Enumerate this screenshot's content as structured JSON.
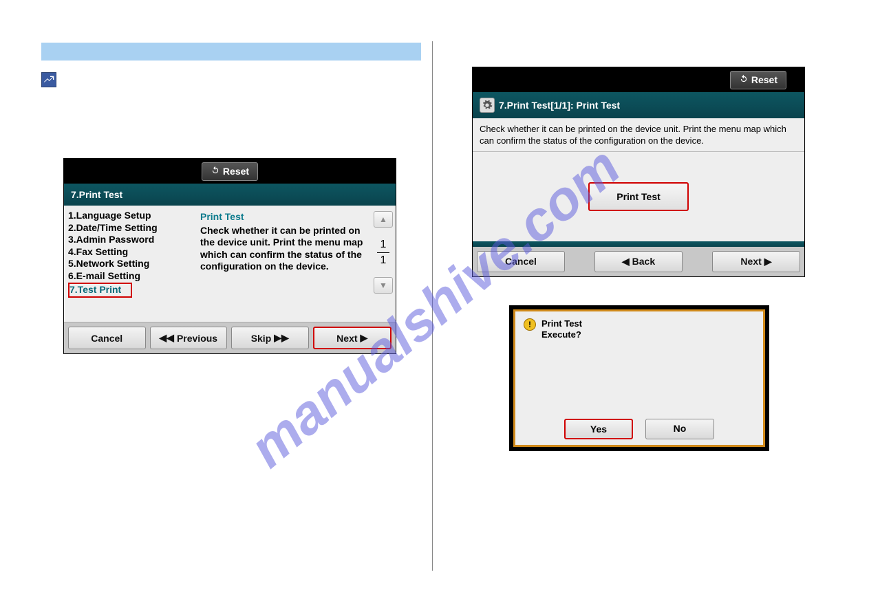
{
  "watermark": "manualshive.com",
  "shot1": {
    "reset_label": "Reset",
    "header": "7.Print Test",
    "menu": [
      "1.Language Setup",
      "2.Date/Time Setting",
      "3.Admin Password",
      "4.Fax Setting",
      "5.Network Setting",
      "6.E-mail Setting",
      "7.Test Print"
    ],
    "desc_title": "Print Test",
    "desc_body": "Check whether it can be printed on the device unit. Print the menu map which can confirm the status of the configuration on the device.",
    "page_current": "1",
    "page_total": "1",
    "btn_cancel": "Cancel",
    "btn_previous": "Previous",
    "btn_skip": "Skip",
    "btn_next": "Next"
  },
  "shot2": {
    "reset_label": "Reset",
    "header": "7.Print Test[1/1]: Print Test",
    "instruction": "Check whether it can be printed on the device unit. Print the menu map which can confirm the status of the configuration on the device.",
    "btn_print_test": "Print Test",
    "btn_cancel": "Cancel",
    "btn_back": "Back",
    "btn_next": "Next"
  },
  "shot3": {
    "line1": "Print Test",
    "line2": "Execute?",
    "btn_yes": "Yes",
    "btn_no": "No"
  }
}
